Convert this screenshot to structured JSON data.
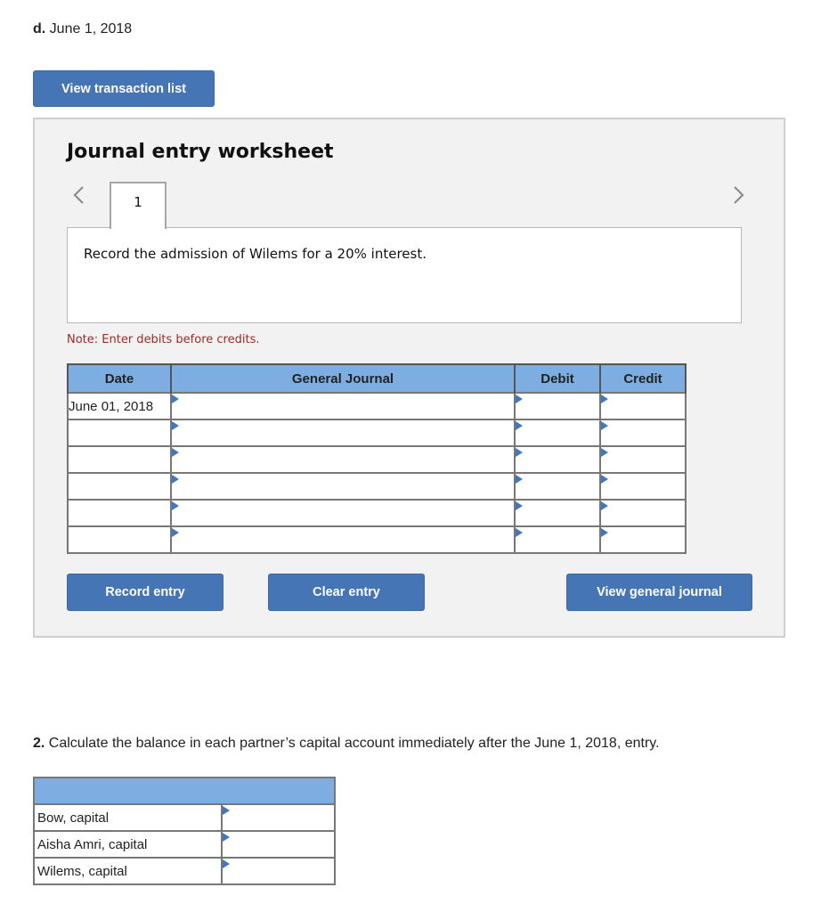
{
  "part": {
    "letter": "d.",
    "date": "June 1, 2018"
  },
  "buttons": {
    "view_transaction_list": "View transaction list",
    "record_entry": "Record entry",
    "clear_entry": "Clear entry",
    "view_general_journal": "View general journal"
  },
  "worksheet": {
    "title": "Journal entry worksheet",
    "prev_icon": "chevron-left-icon",
    "next_icon": "chevron-right-icon",
    "tabs": [
      {
        "label": "1",
        "active": true
      }
    ],
    "instruction": "Record the admission of Wilems for a 20% interest.",
    "note": "Note: Enter debits before credits.",
    "columns": [
      "Date",
      "General Journal",
      "Debit",
      "Credit"
    ],
    "rows": [
      {
        "date": "June 01, 2018",
        "account": "",
        "debit": "",
        "credit": ""
      },
      {
        "date": "",
        "account": "",
        "debit": "",
        "credit": ""
      },
      {
        "date": "",
        "account": "",
        "debit": "",
        "credit": ""
      },
      {
        "date": "",
        "account": "",
        "debit": "",
        "credit": ""
      },
      {
        "date": "",
        "account": "",
        "debit": "",
        "credit": ""
      },
      {
        "date": "",
        "account": "",
        "debit": "",
        "credit": ""
      }
    ]
  },
  "question2": {
    "number": "2.",
    "text": "Calculate the balance in each partner’s capital account immediately after the June 1, 2018, entry.",
    "rows": [
      {
        "label": "Bow, capital",
        "value": ""
      },
      {
        "label": "Aisha Amri, capital",
        "value": ""
      },
      {
        "label": "Wilems, capital",
        "value": ""
      }
    ]
  },
  "colors": {
    "button": "#4575b5",
    "header": "#7eaee1",
    "note": "#a02929",
    "dropdown_marker": "#3f78c0"
  }
}
